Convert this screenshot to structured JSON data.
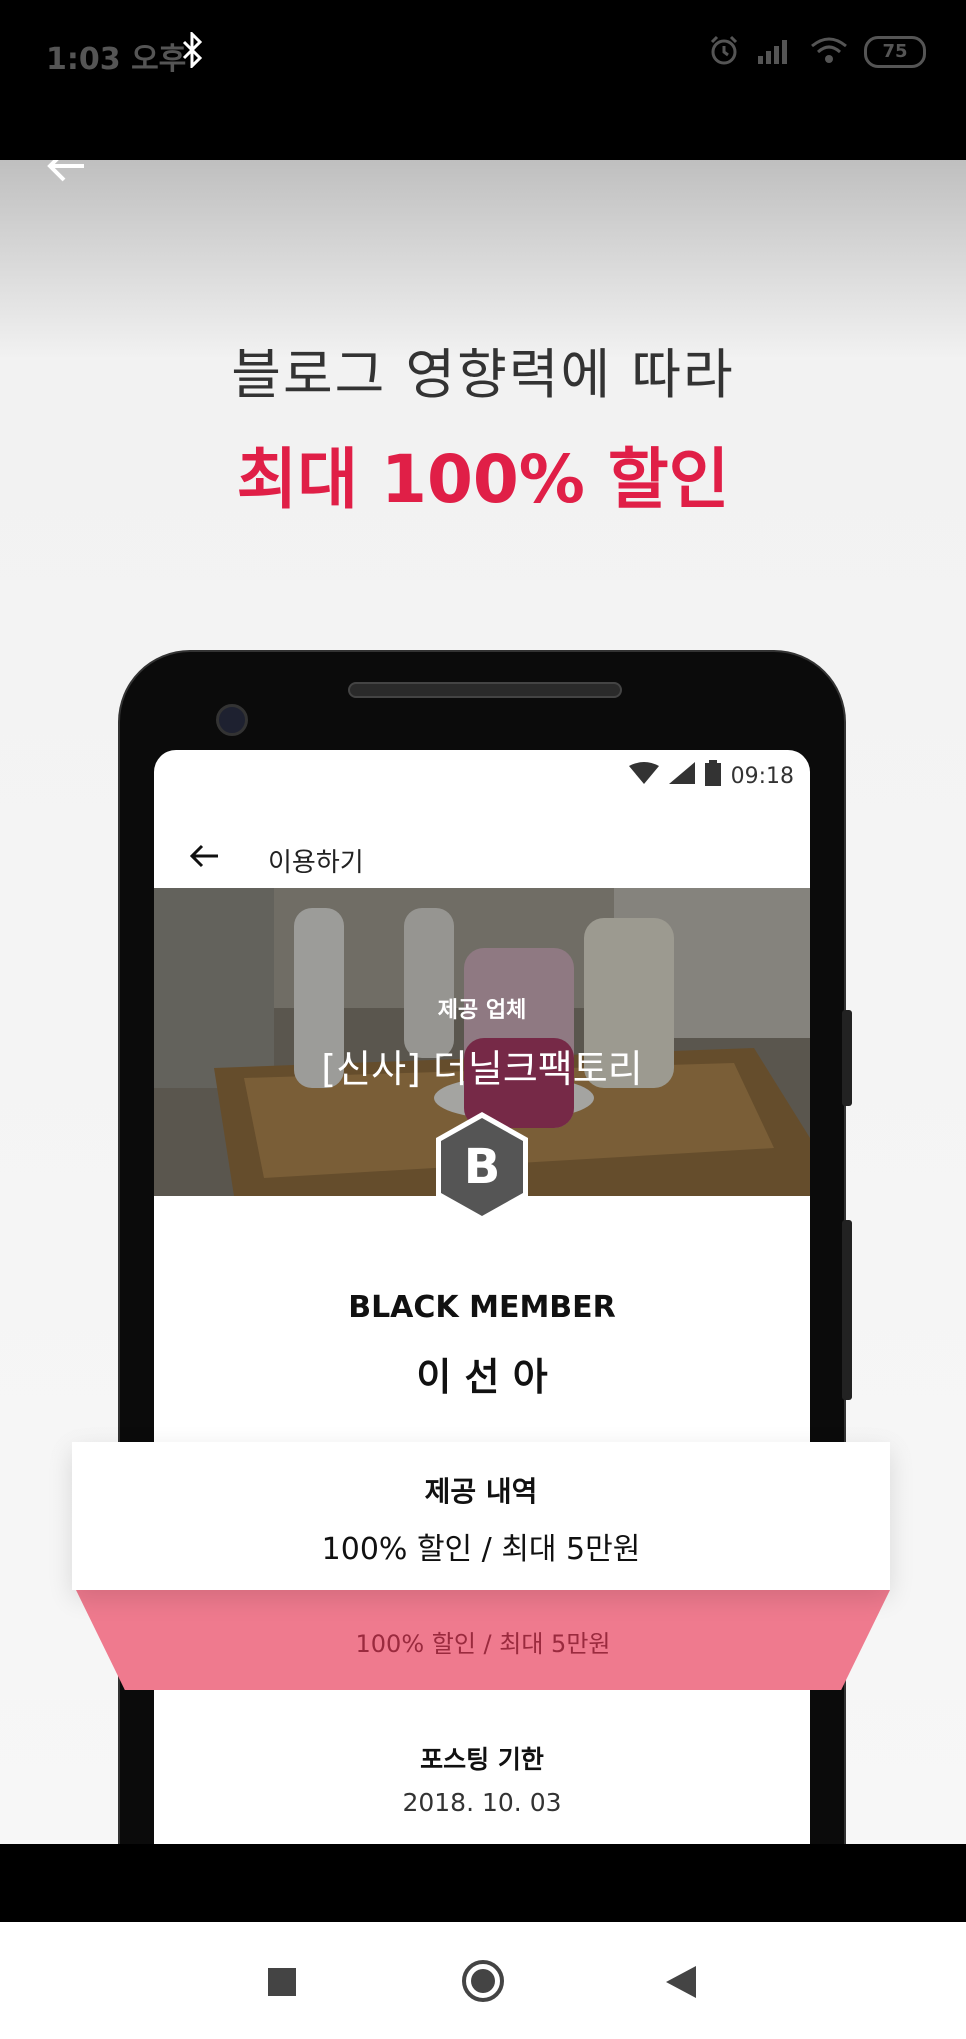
{
  "status_bar": {
    "time": "1:03 오후",
    "battery": "75",
    "icons": [
      "bluetooth-icon",
      "alarm-icon",
      "signal-icon",
      "wifi-icon",
      "battery-icon"
    ]
  },
  "hero": {
    "headline_line1": "블로그 영향력에 따라",
    "headline_line2": "최대 100% 할인",
    "accent_color": "#e01f47"
  },
  "mock_phone": {
    "status_time": "09:18",
    "app_title": "이용하기",
    "photo_label": "제공 업체",
    "business_name": "[신사] 더닐크팩토리",
    "badge_letter": "B",
    "member_level": "BLACK MEMBER",
    "member_name": "이 선 아",
    "under_offer_text": "100% 할인 / 최대 5만원",
    "deadline_label": "포스팅 기한",
    "deadline_value": "2018. 10. 03"
  },
  "offer_card": {
    "title": "제공 내역",
    "value": "100% 할인 / 최대 5만원"
  },
  "ribbon_color": "#ef7a8e",
  "nav_bar": {
    "buttons": [
      "recents-button",
      "home-button",
      "back-button"
    ]
  }
}
